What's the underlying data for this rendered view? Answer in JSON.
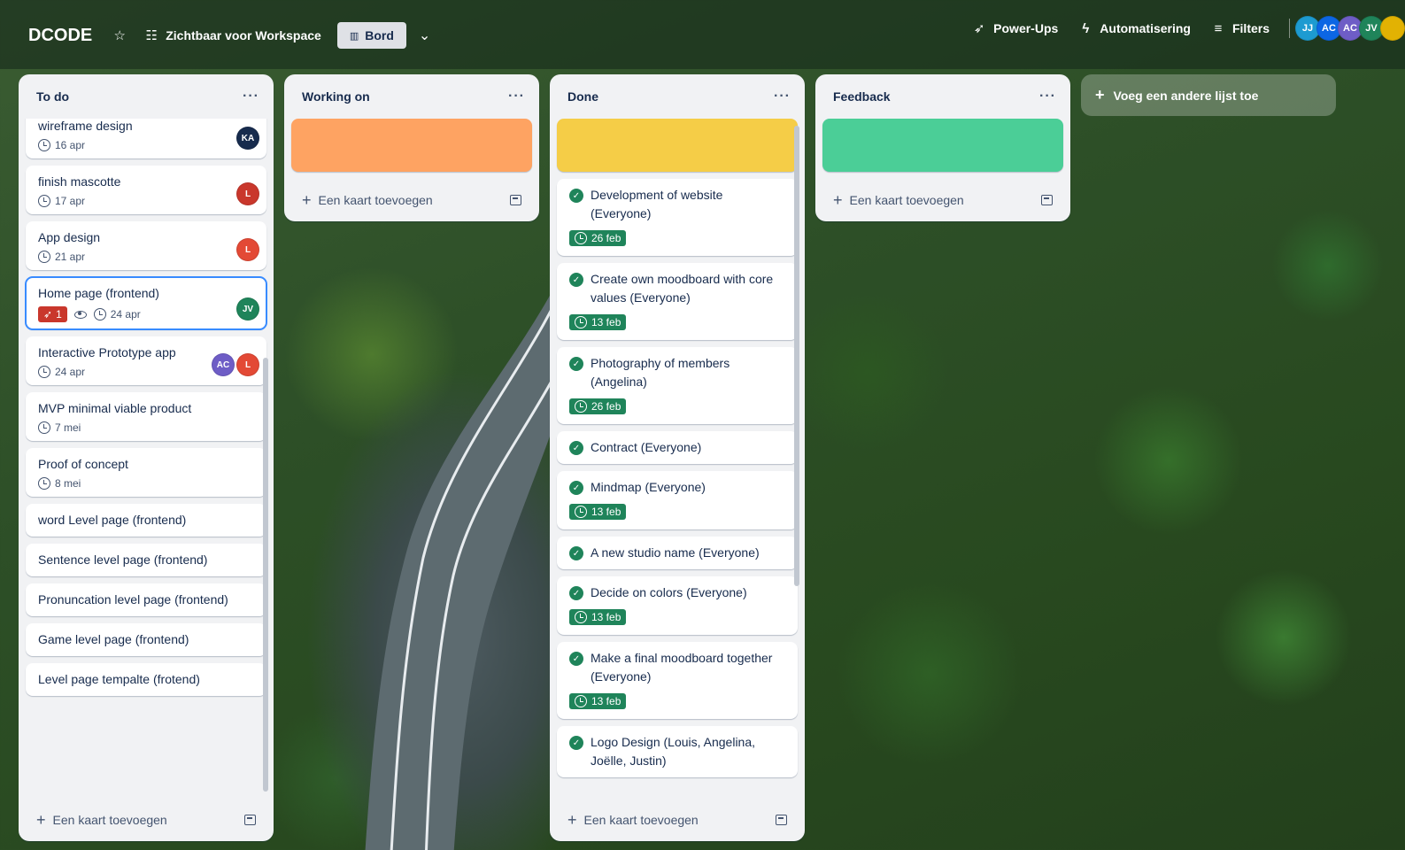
{
  "topbar": {
    "board_name": "DCODE",
    "visibility_label": "Zichtbaar voor Workspace",
    "view_label": "Bord",
    "powerups_label": "Power-Ups",
    "automation_label": "Automatisering",
    "filters_label": "Filters",
    "members": [
      {
        "initials": "JJ",
        "color": "#1d9bd1"
      },
      {
        "initials": "AC",
        "color": "#0c66e4"
      },
      {
        "initials": "AC",
        "color": "#6e5dc6"
      },
      {
        "initials": "JV",
        "color": "#1f845a"
      },
      {
        "initials": "",
        "color": "#e2b203"
      }
    ]
  },
  "lists": [
    {
      "title": "To do",
      "add_label": "Een kaart toevoegen",
      "cards": [
        {
          "title": "wireframe design",
          "due": "16 apr",
          "avatars": [
            {
              "initials": "KA",
              "color": "#172b4d"
            }
          ]
        },
        {
          "title": "finish mascotte",
          "due": "17 apr",
          "avatars": [
            {
              "initials": "L",
              "color": "#c9372c"
            }
          ]
        },
        {
          "title": "App design",
          "due": "21 apr",
          "avatars": [
            {
              "initials": "L",
              "color": "#e34935"
            }
          ]
        },
        {
          "title": "Home page (frontend)",
          "notifications": "1",
          "due": "24 apr",
          "avatars": [
            {
              "initials": "JV",
              "color": "#1f845a"
            }
          ]
        },
        {
          "title": "Interactive Prototype app",
          "due": "24 apr",
          "avatars": [
            {
              "initials": "AC",
              "color": "#6e5dc6"
            },
            {
              "initials": "L",
              "color": "#e34935"
            }
          ]
        },
        {
          "title": "MVP minimal viable product",
          "due": "7 mei"
        },
        {
          "title": "Proof of concept",
          "due": "8 mei"
        },
        {
          "title": "word Level page (frontend)"
        },
        {
          "title": "Sentence level page (frontend)"
        },
        {
          "title": "Pronuncation level page (frontend)"
        },
        {
          "title": "Game level page (frontend)"
        },
        {
          "title": "Level page tempalte (frotend)"
        }
      ]
    },
    {
      "title": "Working on",
      "cover_color": "#fea362",
      "add_label": "Een kaart toevoegen"
    },
    {
      "title": "Done",
      "cover_color": "#f5cd47",
      "add_label": "Een kaart toevoegen",
      "cards": [
        {
          "title": "Development of website (Everyone)",
          "due": "26 feb"
        },
        {
          "title": "Create own moodboard with core values (Everyone)",
          "due": "13 feb"
        },
        {
          "title": "Photography of members (Angelina)",
          "due": "26 feb"
        },
        {
          "title": "Contract (Everyone)"
        },
        {
          "title": "Mindmap (Everyone)",
          "due": "13 feb"
        },
        {
          "title": "A new studio name (Everyone)"
        },
        {
          "title": "Decide on colors (Everyone)",
          "due": "13 feb"
        },
        {
          "title": "Make a final moodboard together (Everyone)",
          "due": "13 feb"
        },
        {
          "title": "Logo Design (Louis, Angelina, Joëlle, Justin)"
        }
      ]
    },
    {
      "title": "Feedback",
      "cover_color": "#4bce97",
      "add_label": "Een kaart toevoegen"
    }
  ],
  "add_list_label": "Voeg een andere lijst toe"
}
